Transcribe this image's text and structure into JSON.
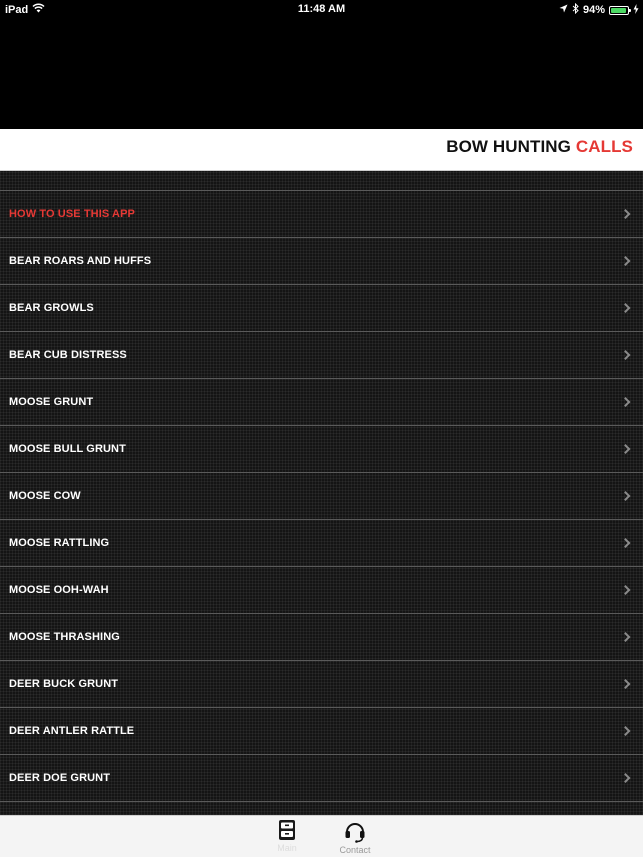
{
  "status_bar": {
    "device": "iPad",
    "time": "11:48 AM",
    "battery": "94%",
    "battery_level": 0.94,
    "battery_color": "#4cd964"
  },
  "header": {
    "title_main": "BOW HUNTING",
    "title_accent": "CALLS",
    "accent_color": "#e53935"
  },
  "list": {
    "items": [
      {
        "label": "HOW TO USE THIS APP",
        "highlight": true
      },
      {
        "label": "BEAR ROARS AND HUFFS",
        "highlight": false
      },
      {
        "label": "BEAR GROWLS",
        "highlight": false
      },
      {
        "label": "BEAR CUB DISTRESS",
        "highlight": false
      },
      {
        "label": "MOOSE GRUNT",
        "highlight": false
      },
      {
        "label": "MOOSE BULL GRUNT",
        "highlight": false
      },
      {
        "label": "MOOSE COW",
        "highlight": false
      },
      {
        "label": "MOOSE RATTLING",
        "highlight": false
      },
      {
        "label": "MOOSE OOH-WAH",
        "highlight": false
      },
      {
        "label": "MOOSE THRASHING",
        "highlight": false
      },
      {
        "label": "DEER BUCK GRUNT",
        "highlight": false
      },
      {
        "label": "DEER ANTLER RATTLE",
        "highlight": false
      },
      {
        "label": "DEER DOE GRUNT",
        "highlight": false
      }
    ]
  },
  "tab_bar": {
    "tabs": [
      {
        "label": "Main",
        "icon": "cabinet-icon",
        "selected": true
      },
      {
        "label": "Contact",
        "icon": "headset-icon",
        "selected": false
      }
    ]
  }
}
